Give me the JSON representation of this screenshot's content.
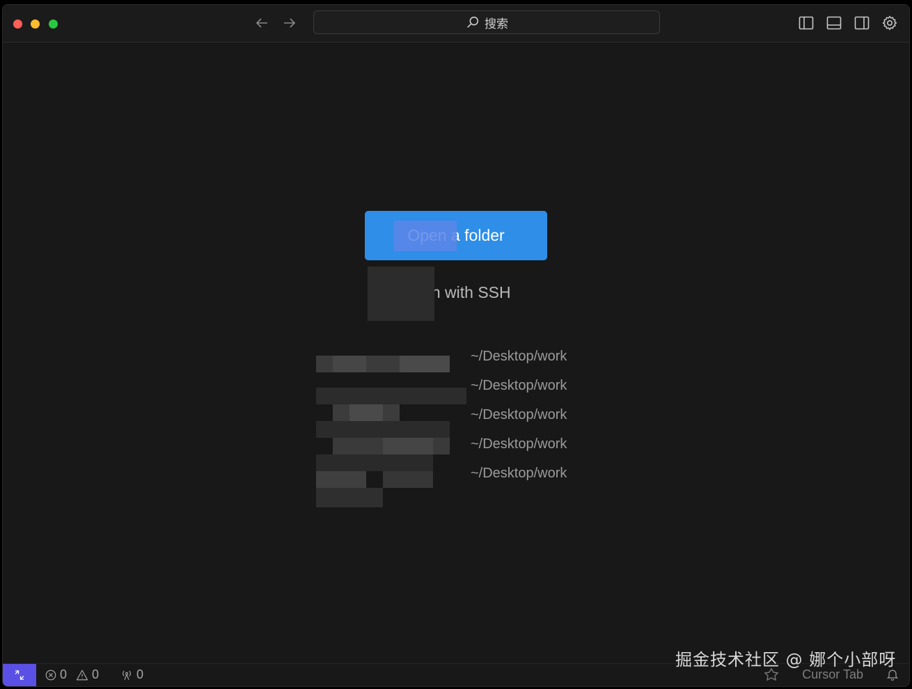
{
  "window": {
    "search_placeholder": "搜索"
  },
  "main": {
    "open_button_label": "Open a folder",
    "ssh_link_label": "Open with SSH",
    "recent_projects": [
      {
        "name": "",
        "path": "~/Desktop/work"
      },
      {
        "name": "",
        "path": "~/Desktop/work"
      },
      {
        "name": "",
        "path": "~/Desktop/work"
      },
      {
        "name": "",
        "path": "~/Desktop/work"
      },
      {
        "name": "",
        "path": "~/Desktop/work"
      }
    ]
  },
  "statusbar": {
    "errors": "0",
    "warnings": "0",
    "ports": "0",
    "cursor_tab": "Cursor Tab"
  },
  "watermark": "掘金技术社区 @ 娜个小部呀",
  "colors": {
    "accent": "#2e8ee8",
    "remote": "#5b50e6",
    "background": "#181818"
  },
  "icons": [
    "close-dot",
    "minimize-dot",
    "maximize-dot",
    "arrow-left-icon",
    "arrow-right-icon",
    "search-icon",
    "toggle-primary-sidebar-icon",
    "toggle-panel-icon",
    "toggle-secondary-sidebar-icon",
    "gear-icon",
    "remote-icon",
    "error-icon",
    "warning-icon",
    "ports-icon",
    "cursor-brain-icon",
    "bell-icon"
  ]
}
